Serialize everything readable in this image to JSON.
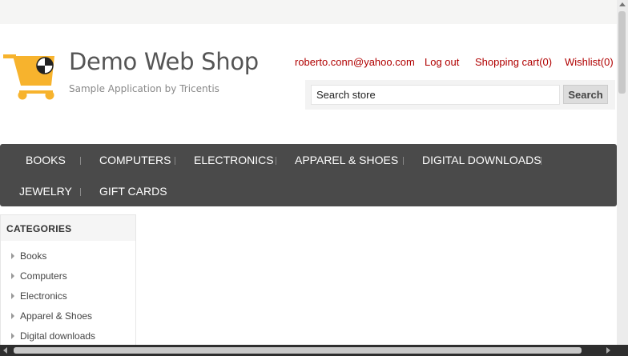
{
  "site": {
    "title": "Demo Web Shop",
    "subtitle": "Sample Application by Tricentis",
    "logo_icon": "shopping-cart-icon",
    "brand_color": "#f7b32d"
  },
  "header_links": {
    "account": "roberto.conn@yahoo.com",
    "logout": "Log out",
    "cart": "Shopping cart(0)",
    "wishlist": "Wishlist(0)",
    "link_color": "#b00000"
  },
  "search": {
    "value": "Search store",
    "button_label": "Search"
  },
  "menu": {
    "items": [
      "BOOKS",
      "COMPUTERS",
      "ELECTRONICS",
      "APPAREL & SHOES",
      "DIGITAL DOWNLOADS",
      "JEWELRY",
      "GIFT CARDS"
    ],
    "background": "#4a4a4a"
  },
  "categories": {
    "title": "CATEGORIES",
    "items": [
      "Books",
      "Computers",
      "Electronics",
      "Apparel & Shoes",
      "Digital downloads"
    ]
  }
}
